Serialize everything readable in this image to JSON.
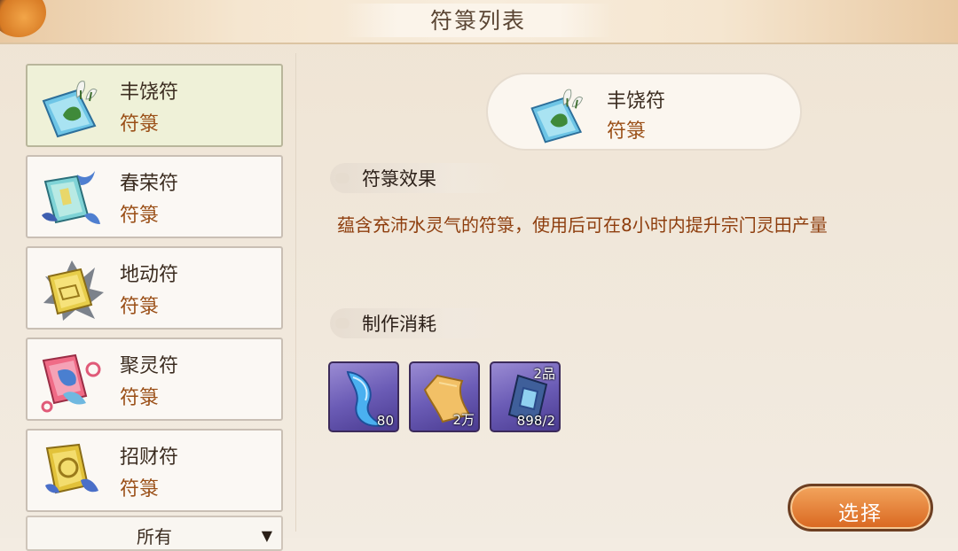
{
  "header": {
    "title": "符箓列表"
  },
  "sidebar": {
    "items": [
      {
        "name": "丰饶符",
        "category": "符箓",
        "icon": "fengrao-talisman-icon",
        "selected": true
      },
      {
        "name": "春荣符",
        "category": "符箓",
        "icon": "chunrong-talisman-icon",
        "selected": false
      },
      {
        "name": "地动符",
        "category": "符箓",
        "icon": "didong-talisman-icon",
        "selected": false
      },
      {
        "name": "聚灵符",
        "category": "符箓",
        "icon": "juling-talisman-icon",
        "selected": false
      },
      {
        "name": "招财符",
        "category": "符箓",
        "icon": "zhaocai-talisman-icon",
        "selected": false
      }
    ],
    "filter": {
      "label": "所有"
    }
  },
  "detail": {
    "name": "丰饶符",
    "category": "符箓",
    "effect_title": "符箓效果",
    "effect_text": "蕴含充沛水灵气的符箓，使用后可在8小时内提升宗门灵田产量",
    "cost_title": "制作消耗",
    "materials": [
      {
        "icon": "water-silk-icon",
        "quantity": "80",
        "grade": ""
      },
      {
        "icon": "talisman-paper-icon",
        "quantity": "2万",
        "grade": ""
      },
      {
        "icon": "spirit-crystal-icon",
        "quantity": "898/2",
        "grade": "2品"
      }
    ],
    "select_label": "选择"
  },
  "colors": {
    "name_text": "#3b2c20",
    "category_text": "#9a4f17",
    "description_text": "#8e3e0e",
    "selected_item_bg": "#eff1d8",
    "material_bg": "#6b5cb6",
    "select_button": "#e27a30"
  }
}
